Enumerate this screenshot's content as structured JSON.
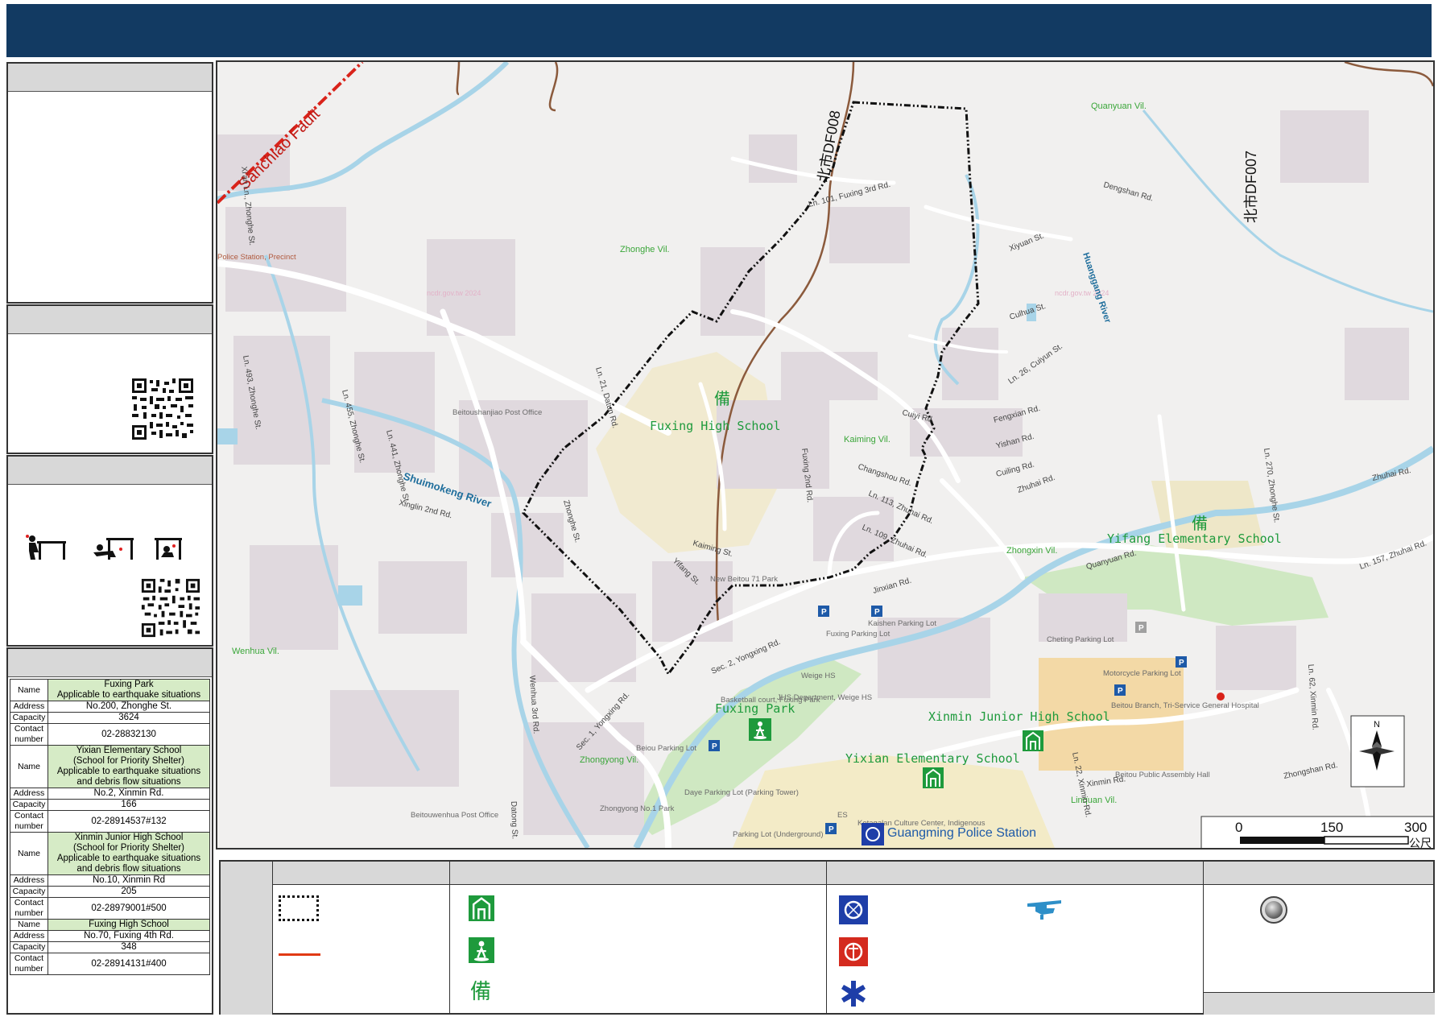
{
  "map": {
    "fault_label": "Sanchiao Fault",
    "zone_label": "北市DF008",
    "zone_label_2": "北市DF007",
    "watermark": "ncdr.gov.tw 2024",
    "villages": [
      "Quanyuan Vil.",
      "Zhonghe Vil.",
      "Kaiming Vil.",
      "Zhongxin Vil.",
      "Wenhua Vil.",
      "Zhongyong Vil.",
      "Linquan Vil."
    ],
    "rivers": [
      "Shuimokeng River",
      "Huanggang River"
    ],
    "roads": [
      "Ln. 101, Fuxing 3rd Rd.",
      "Dengshan Rd.",
      "Xiyuan St.",
      "Culhua St.",
      "Ln. 26, Cuiyun St.",
      "Fengxian Rd.",
      "Yishan Rd.",
      "Cuiling Rd.",
      "Zhuhai Rd.",
      "Ln. 113, Zhuhai Rd.",
      "Ln. 109, Zhuhai Rd.",
      "Changshou Rd.",
      "Cuiyi Rd.",
      "Fuxing 2nd Rd.",
      "Ln. 21, Datun Rd.",
      "Kaiming St.",
      "Yifang St.",
      "Jinxian Rd.",
      "Sec. 2, Yongxing Rd.",
      "Sec. 1, Yongxing Rd.",
      "Xinglin 2nd Rd.",
      "Zhonghe St.",
      "Ln. 493, Zhonghe St.",
      "Ln. 455, Zhonghe St.",
      "Ln. 441, Zhonghe St.",
      "Wenhua 3rd Rd.",
      "Datong St.",
      "Xinmin Rd.",
      "Ln. 22, Xinmin Rd.",
      "Ln. 62, Xinmin Rd.",
      "Zhongshan Rd.",
      "Quanyuan Rd.",
      "Zhuhai Rd.",
      "Ln. 157, Zhuhai Rd.",
      "Ln. 270, Zhonghe St.",
      "Xi'an Ln., Zhonghe St."
    ],
    "schools": [
      "Fuxing High School",
      "Yifang Elementary School",
      "Xinmin Junior High School",
      "Yixian Elementary School"
    ],
    "parks": [
      "Fuxing Park"
    ],
    "police": "Guangming Police Station",
    "pois": [
      "Beitoushanjiao Post Office",
      "New Beitou 71 Park",
      "Fuxing Parking Lot",
      "Kaishen Parking Lot",
      "Cheting Parking Lot",
      "Motorcycle Parking Lot",
      "Beitou Branch, Tri-Service General Hospital",
      "Beitou Public Assembly Hall",
      "Weige HS",
      "JHS Department, Weige HS",
      "Basketball court, Fuxing Park",
      "Beiou Parking Lot",
      "Daye Parking Lot (Parking Tower)",
      "Zhongyong No.1 Park",
      "Beitouwenhua Post Office",
      "Ketagalan Culture Center, Indigenous",
      "Parking Lot (Underground)",
      "Police Station, Precinct",
      "ES"
    ],
    "scale": {
      "ticks": [
        "0",
        "150",
        "300"
      ],
      "unit": "公尺"
    },
    "north": "N"
  },
  "shelters": [
    {
      "rows": [
        {
          "key": "Name",
          "value": "Fuxing Park\nApplicable to earthquake situations",
          "hl": true
        },
        {
          "key": "Address",
          "value": "No.200, Zhonghe St."
        },
        {
          "key": "Capacity",
          "value": "3624"
        },
        {
          "key": "Contact number",
          "value": "02-28832130"
        }
      ]
    },
    {
      "rows": [
        {
          "key": "Name",
          "value": "Yixian Elementary School\n(School for Priority Shelter)\nApplicable to earthquake situations\nand debris flow situations",
          "hl": true
        },
        {
          "key": "Address",
          "value": "No.2, Xinmin Rd."
        },
        {
          "key": "Capacity",
          "value": "166"
        },
        {
          "key": "Contact number",
          "value": "02-28914537#132"
        }
      ]
    },
    {
      "rows": [
        {
          "key": "Name",
          "value": "Xinmin Junior High School\n(School for Priority Shelter)\nApplicable to earthquake situations\nand debris flow situations",
          "hl": true
        },
        {
          "key": "Address",
          "value": "No.10, Xinmin Rd"
        },
        {
          "key": "Capacity",
          "value": "205"
        },
        {
          "key": "Contact number",
          "value": "02-28979001#500"
        }
      ]
    },
    {
      "rows": [
        {
          "key": "Name",
          "value": "Fuxing High School",
          "hl": true
        },
        {
          "key": "Address",
          "value": "No.70, Fuxing 4th Rd."
        },
        {
          "key": "Capacity",
          "value": "348"
        },
        {
          "key": "Contact number",
          "value": "02-28914131#400"
        }
      ]
    }
  ],
  "legend": {
    "backup_symbol": "備"
  },
  "colors": {
    "header": "#123a62",
    "shelter_green": "#1e9a3c",
    "fault_red": "#d9231a",
    "river": "#a8d4e8",
    "police_blue": "#1e3ea8"
  }
}
